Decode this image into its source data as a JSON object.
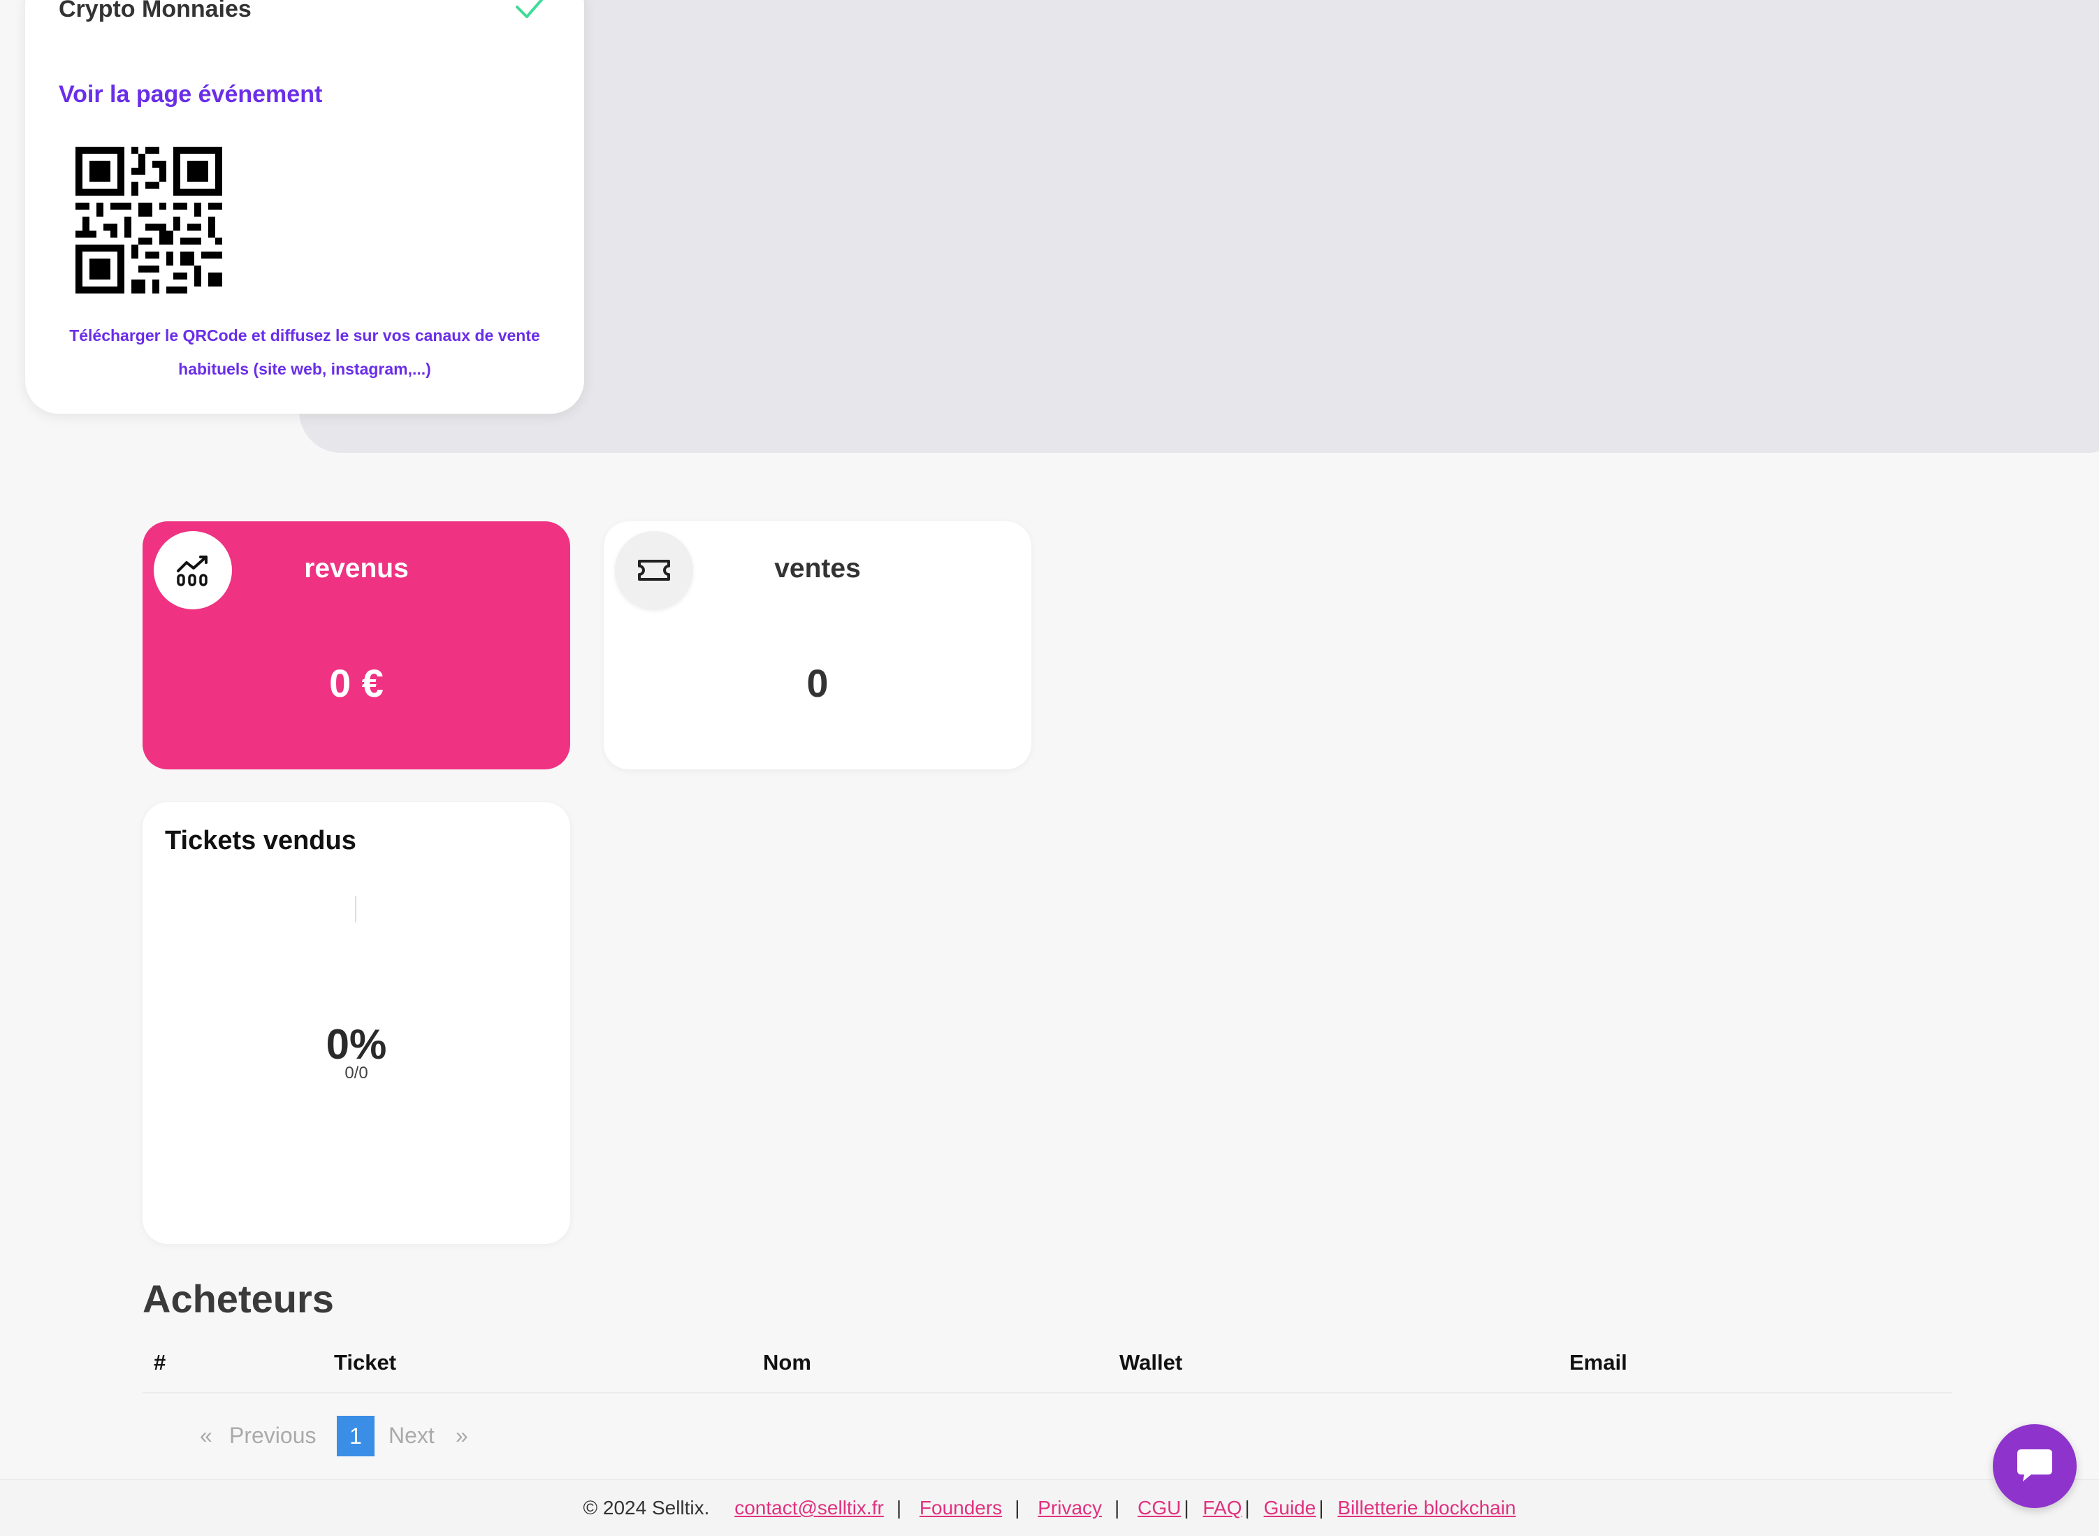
{
  "event_card": {
    "crypto_label": "Crypto Monnaies",
    "event_link": "Voir la page événement",
    "qr_caption": "Télécharger le QRCode et diffusez le sur vos canaux de vente habituels (site web, instagram,...)"
  },
  "stats": {
    "revenue": {
      "title": "revenus",
      "value": "0 €",
      "icon": "chart-icon",
      "color": "#ef3282"
    },
    "sales": {
      "title": "ventes",
      "value": "0",
      "icon": "ticket-icon"
    }
  },
  "tickets": {
    "title": "Tickets vendus",
    "percent": "0%",
    "ratio": "0/0",
    "progress_fraction": 0
  },
  "buyers": {
    "heading": "Acheteurs",
    "columns": [
      "#",
      "Ticket",
      "Nom",
      "Wallet",
      "Email"
    ],
    "rows": []
  },
  "pagination": {
    "first": "«",
    "previous": "Previous",
    "current": "1",
    "next": "Next",
    "last": "»"
  },
  "footer": {
    "copyright": "© 2024 Selltix.",
    "links": [
      "contact@selltix.fr",
      "Founders",
      "Privacy",
      "CGU",
      "FAQ",
      "Guide",
      "Billetterie blockchain"
    ]
  },
  "colors": {
    "accent_purple": "#6a2ee8",
    "accent_pink": "#ef3282",
    "check_green": "#3ddc97",
    "chat_purple": "#8e33cc",
    "page_active_blue": "#3a8ee6"
  }
}
